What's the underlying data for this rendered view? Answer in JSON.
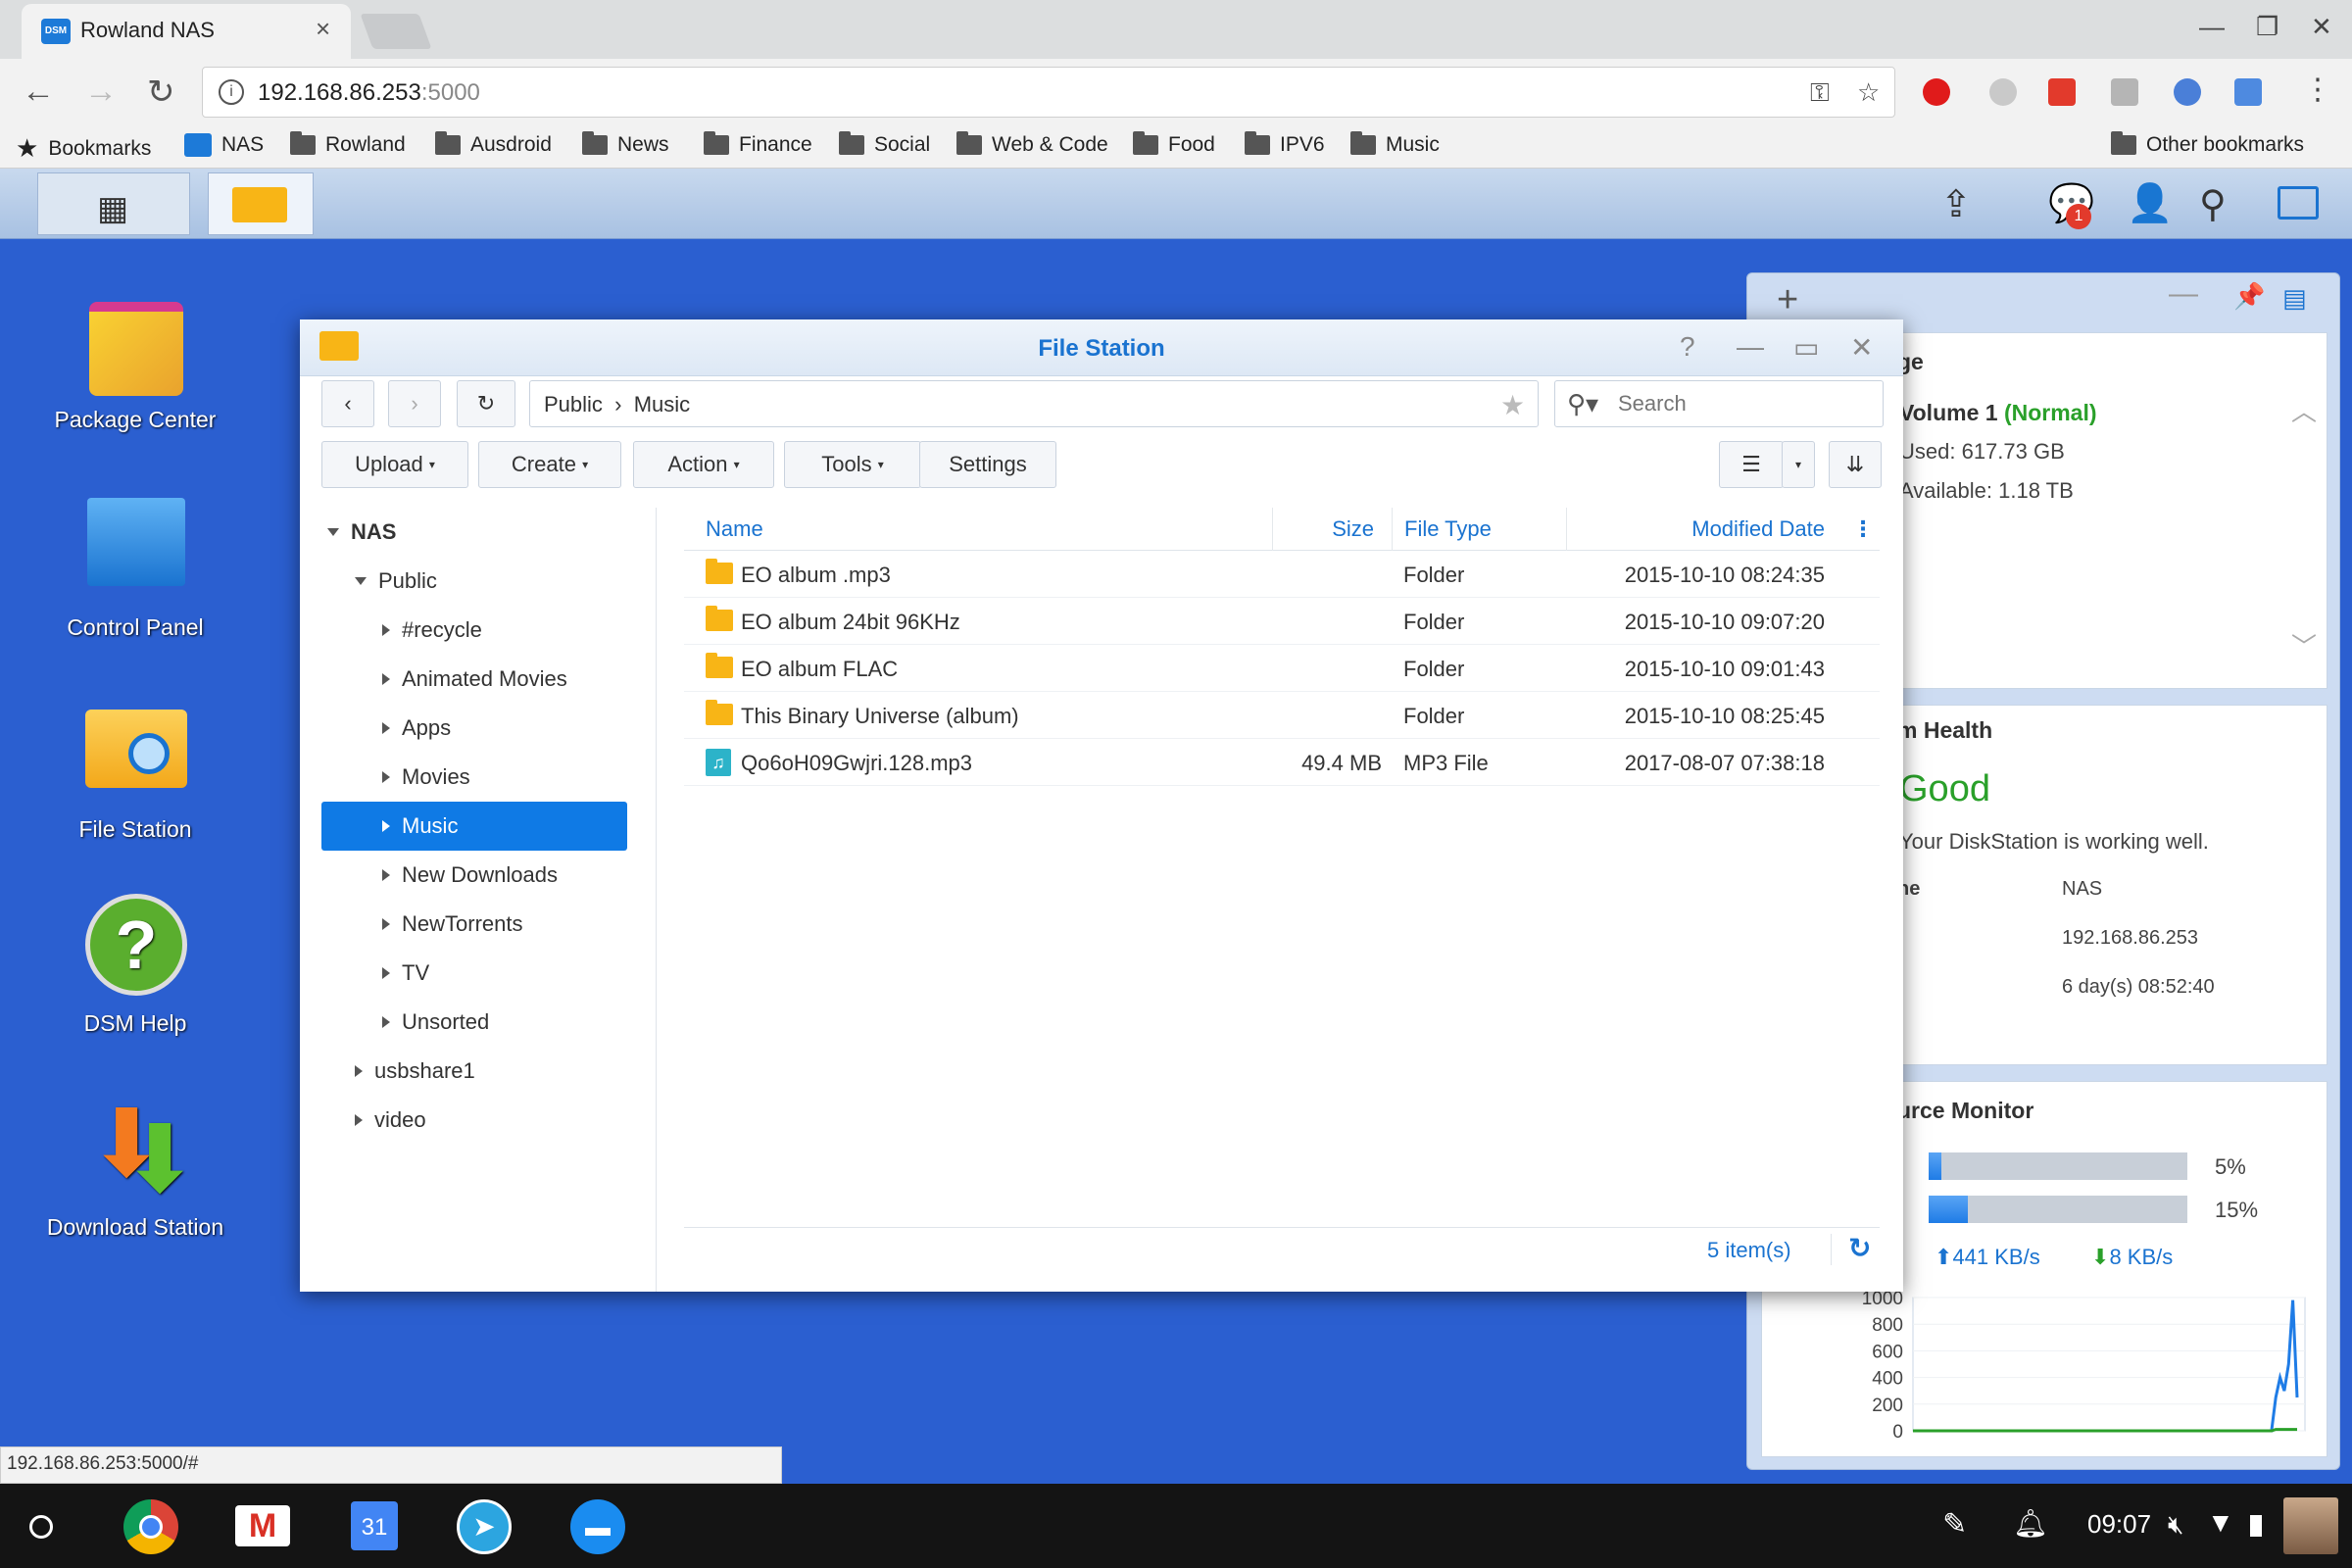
{
  "browser": {
    "tab_title": "Rowland NAS",
    "tab_favicon": "DSM",
    "url_host": "192.168.86.253",
    "url_port": ":5000",
    "status_url": "192.168.86.253:5000/#"
  },
  "bookmarks": {
    "items": [
      "Bookmarks",
      "NAS",
      "Rowland",
      "Ausdroid",
      "News",
      "Finance",
      "Social",
      "Web & Code",
      "Food",
      "IPV6",
      "Music"
    ],
    "other": "Other bookmarks"
  },
  "dsm": {
    "notification_count": "1",
    "desktop_icons": [
      "Package Center",
      "Control Panel",
      "File Station",
      "DSM Help",
      "Download Station"
    ]
  },
  "file_station": {
    "title": "File Station",
    "path": [
      "Public",
      "Music"
    ],
    "search_placeholder": "Search",
    "buttons": {
      "upload": "Upload",
      "create": "Create",
      "action": "Action",
      "tools": "Tools",
      "settings": "Settings"
    },
    "tree": {
      "root": "NAS",
      "public": "Public",
      "children": [
        "#recycle",
        "Animated Movies",
        "Apps",
        "Movies",
        "Music",
        "New Downloads",
        "NewTorrents",
        "TV",
        "Unsorted"
      ],
      "others": [
        "usbshare1",
        "video"
      ]
    },
    "columns": {
      "name": "Name",
      "size": "Size",
      "type": "File Type",
      "modified": "Modified Date"
    },
    "rows": [
      {
        "name": "EO album .mp3",
        "size": "",
        "type": "Folder",
        "modified": "2015-10-10 08:24:35",
        "icon": "folder-icon"
      },
      {
        "name": "EO album 24bit 96KHz",
        "size": "",
        "type": "Folder",
        "modified": "2015-10-10 09:07:20",
        "icon": "folder-icon"
      },
      {
        "name": "EO album FLAC",
        "size": "",
        "type": "Folder",
        "modified": "2015-10-10 09:01:43",
        "icon": "folder-icon"
      },
      {
        "name": "This Binary Universe (album)",
        "size": "",
        "type": "Folder",
        "modified": "2015-10-10 08:25:45",
        "icon": "folder-icon"
      },
      {
        "name": "Qo6oH09Gwjri.128.mp3",
        "size": "49.4 MB",
        "type": "MP3 File",
        "modified": "2017-08-07 07:38:18",
        "icon": "music-file-icon"
      }
    ],
    "item_count": "5 item(s)"
  },
  "widgets": {
    "storage": {
      "title_fragment": "ge",
      "volume": "Volume 1",
      "status": "(Normal)",
      "used": "Used: 617.73 GB",
      "available": "Available: 1.18 TB"
    },
    "health": {
      "title_fragment": "m Health",
      "status": "Good",
      "message": "Your DiskStation is working well.",
      "label_fragment": "ne",
      "server_name": "NAS",
      "ip": "192.168.86.253",
      "uptime": "6 day(s) 08:52:40"
    },
    "resource": {
      "title_fragment": "urce Monitor",
      "cpu_label": "5%",
      "cpu": 0.05,
      "ram_label": "15%",
      "ram": 0.15,
      "upload": "441 KB/s",
      "download": "8 KB/s"
    }
  },
  "chart_data": {
    "type": "line",
    "yticks": [
      "1000",
      "800",
      "600",
      "400",
      "200",
      "0"
    ],
    "ylim": [
      0,
      1000
    ],
    "series": [
      {
        "color": "#1f7ce6",
        "values": [
          0,
          0,
          0,
          0,
          0,
          0,
          0,
          0,
          0,
          0,
          0,
          0,
          0,
          0,
          0,
          0,
          0,
          0,
          0,
          0,
          0,
          0,
          0,
          0,
          0,
          0,
          0,
          0,
          0,
          0,
          0,
          0,
          0,
          0,
          0,
          0,
          0,
          0,
          0,
          0,
          0,
          0,
          0,
          0,
          0,
          0,
          0,
          0,
          0,
          0,
          0,
          0,
          0,
          0,
          0,
          0,
          0,
          0,
          0,
          0,
          0,
          0,
          0,
          0,
          0,
          0,
          0,
          0,
          0,
          0,
          0,
          0,
          0,
          0,
          0,
          0,
          0,
          0,
          0,
          0,
          0,
          0,
          0,
          0,
          0,
          250,
          400,
          300,
          500,
          980,
          250
        ]
      },
      {
        "color": "#2aa02a",
        "values": [
          0,
          0,
          0,
          0,
          0,
          0,
          0,
          0,
          0,
          0,
          0,
          0,
          0,
          0,
          0,
          0,
          0,
          0,
          0,
          0,
          0,
          0,
          0,
          0,
          0,
          0,
          0,
          0,
          0,
          0,
          0,
          0,
          0,
          0,
          0,
          0,
          0,
          0,
          0,
          0,
          0,
          0,
          0,
          0,
          0,
          0,
          0,
          0,
          0,
          0,
          0,
          0,
          0,
          0,
          0,
          0,
          0,
          0,
          0,
          0,
          0,
          0,
          0,
          0,
          0,
          0,
          0,
          0,
          0,
          0,
          0,
          0,
          0,
          0,
          0,
          0,
          0,
          0,
          0,
          0,
          0,
          0,
          0,
          0,
          0,
          10,
          10,
          10,
          10,
          10,
          10
        ]
      }
    ]
  },
  "shelf": {
    "time": "09:07",
    "calendar_day": "31"
  }
}
